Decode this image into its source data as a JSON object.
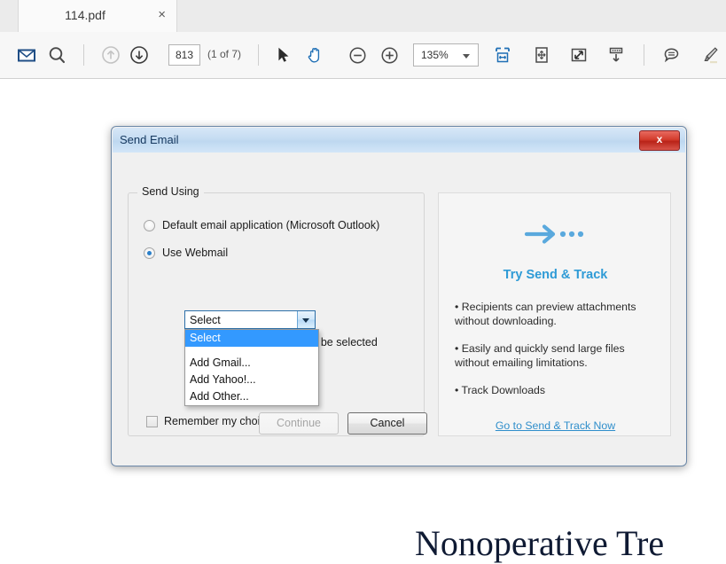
{
  "tab": {
    "title": "114.pdf",
    "close_label": "×"
  },
  "toolbar": {
    "icons": [
      {
        "name": "email-icon",
        "label": "email"
      },
      {
        "name": "search-icon",
        "label": "search"
      },
      {
        "name": "previous-page-icon",
        "label": "previous page"
      },
      {
        "name": "next-page-icon",
        "label": "next page"
      },
      {
        "name": "select-tool-icon",
        "label": "select"
      },
      {
        "name": "hand-tool-icon",
        "label": "pan"
      },
      {
        "name": "zoom-out-icon",
        "label": "zoom out"
      },
      {
        "name": "zoom-in-icon",
        "label": "zoom in"
      },
      {
        "name": "fit-width-icon",
        "label": "fit width"
      },
      {
        "name": "fit-page-icon",
        "label": "fit page"
      },
      {
        "name": "full-screen-icon",
        "label": "full screen"
      },
      {
        "name": "scroll-mode-icon",
        "label": "scroll mode"
      },
      {
        "name": "comment-icon",
        "label": "comment"
      },
      {
        "name": "highlight-icon",
        "label": "highlight"
      }
    ],
    "page_number": "813",
    "page_count": "(1 of 7)",
    "zoom_level": "135%"
  },
  "document": {
    "background_text": "Nonoperative Tre"
  },
  "dialog": {
    "title": "Send Email",
    "close_label": "x",
    "group_legend": "Send Using",
    "radio_default": "Default email application (Microsoft Outlook)",
    "radio_webmail": "Use Webmail",
    "combo_value": "Select",
    "dropdown_options": [
      "Select",
      "Add Gmail...",
      "Add Yahoo!...",
      "Add Other..."
    ],
    "helper_text": "the\nbe selected",
    "checkbox_label": "Remember my choice",
    "continue_label": "Continue",
    "cancel_label": "Cancel",
    "promo": {
      "title": "Try Send & Track",
      "bullet1": "• Recipients can preview attachments without downloading.",
      "bullet2": "• Easily and quickly send large files without emailing limitations.",
      "bullet3": "• Track Downloads",
      "link": "Go to Send & Track Now"
    }
  },
  "colors": {
    "accent": "#2f9bd6",
    "link": "#2f8ecb",
    "highlight": "#3399ff",
    "close_red": "#d33b2c"
  }
}
